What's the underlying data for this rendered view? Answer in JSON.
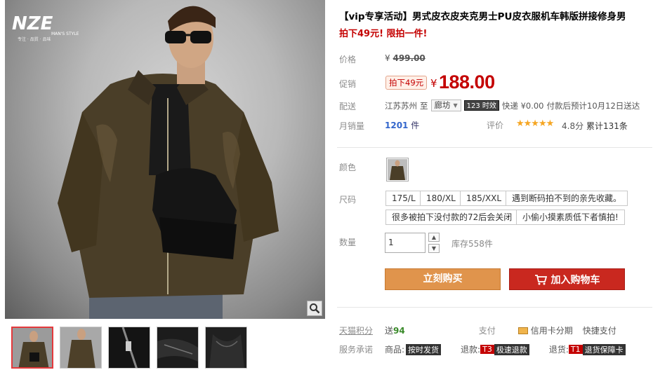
{
  "gallery": {
    "brand_logo_text": "NZE",
    "brand_logo_subtext": "MAN'S STYLE",
    "brand_logo_slogan": "专注 · 品質 · 品味",
    "thumbnails": [
      {
        "alt": "jacket-front"
      },
      {
        "alt": "jacket-side"
      },
      {
        "alt": "zipper-detail"
      },
      {
        "alt": "sleeve-detail"
      },
      {
        "alt": "collar-detail"
      }
    ]
  },
  "product": {
    "title": "【vip专享活动】男式皮衣皮夹克男士PU皮衣服机车韩版拼接修身男",
    "subtitle": "拍下49元! 限拍一件!"
  },
  "price": {
    "orig_label": "价格",
    "orig_currency": "¥",
    "orig_value": "499.00",
    "promo_label": "促销",
    "promo_tag": "拍下49元",
    "promo_currency": "¥",
    "promo_value": "188.00"
  },
  "shipping": {
    "label": "配送",
    "from": "江苏苏州",
    "to_word": "至",
    "city": "廊坊",
    "badge": "123 时效",
    "express": "快递 ¥0.00",
    "note": "付款后预计10月12日送达"
  },
  "sales": {
    "label": "月销量",
    "count": "1201",
    "unit": "件",
    "rating_label": "评价",
    "stars": "★★★★★",
    "score": "4.8分",
    "reviews": "累计131条"
  },
  "options": {
    "color_label": "颜色",
    "size_label": "尺码",
    "sizes": [
      "175/L",
      "180/XL",
      "185/XXL"
    ],
    "notes": [
      "遇到断码拍不到的亲先收藏。",
      "很多被拍下没付款的72后会关闭",
      "小偷小摸素质低下者慎拍!"
    ],
    "qty_label": "数量",
    "qty_value": "1",
    "qty_up": "▲",
    "qty_down": "▼",
    "stock": "库存558件"
  },
  "actions": {
    "buy_now": "立刻购买",
    "add_cart": "加入购物车"
  },
  "extras": {
    "points_label": "天猫积分",
    "points_prefix": "送",
    "points_value": "94",
    "pay_label": "支付",
    "credit": "信用卡分期",
    "quick_pay": "快捷支付",
    "promise_label": "服务承诺",
    "goods_label": "商品:",
    "goods_tag": "按时发货",
    "refund_label": "退款:",
    "refund_code": "T3",
    "refund_tag": "极速退款",
    "return_label": "退货:",
    "return_code": "T1",
    "return_tag": "退货保障卡"
  },
  "colors": {
    "price_red": "#c40000",
    "buy_orange": "#e0944c",
    "cart_red": "#c9281f",
    "star_gold": "#f5a623"
  }
}
